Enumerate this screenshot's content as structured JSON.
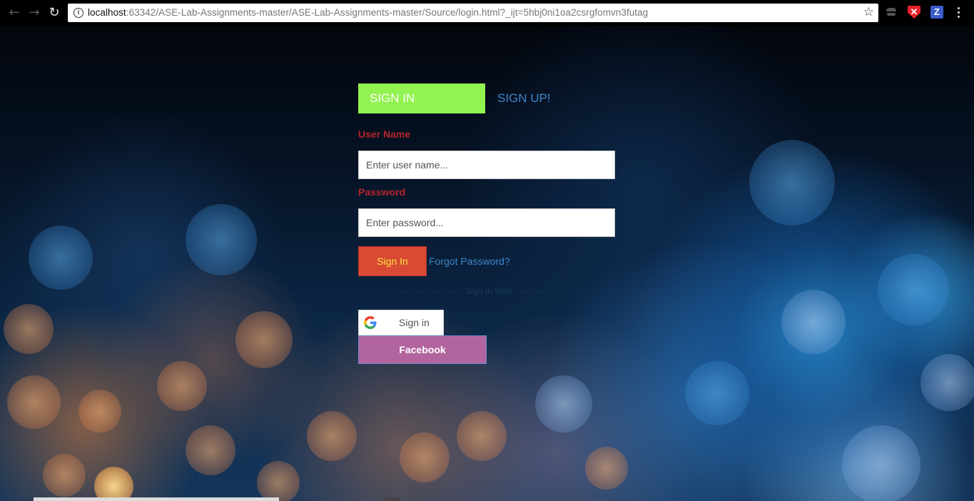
{
  "browser": {
    "url_host": "localhost",
    "url_rest": ":63342/ASE-Lab-Assignments-master/ASE-Lab-Assignments-master/Source/login.html?_ijt=5hbj0ni1oa2csrgfomvn3futag",
    "extensions": [
      "spy-icon",
      "shield-icon",
      "z-icon"
    ],
    "shield_letter": "✕",
    "z_letter": "Z"
  },
  "login": {
    "tab_signin": "SIGN IN",
    "tab_signup": "SIGN UP!",
    "username_label": "User Name",
    "username_placeholder": "Enter user name...",
    "password_label": "Password",
    "password_placeholder": "Enter password...",
    "signin_button": "Sign In",
    "forgot_link": "Forgot Password?",
    "divider_text": "- - - - - - - - - - - - - Sign In With - - - - - - - - - - - - -",
    "google_button": "Sign in",
    "facebook_button": "Facebook"
  },
  "colors": {
    "tab_active": "#92f24f",
    "link": "#3f86c9",
    "label": "#b2262a",
    "signin_bg": "#d94a34",
    "signin_text": "#f5e23a",
    "facebook_bg": "#b1649d"
  }
}
